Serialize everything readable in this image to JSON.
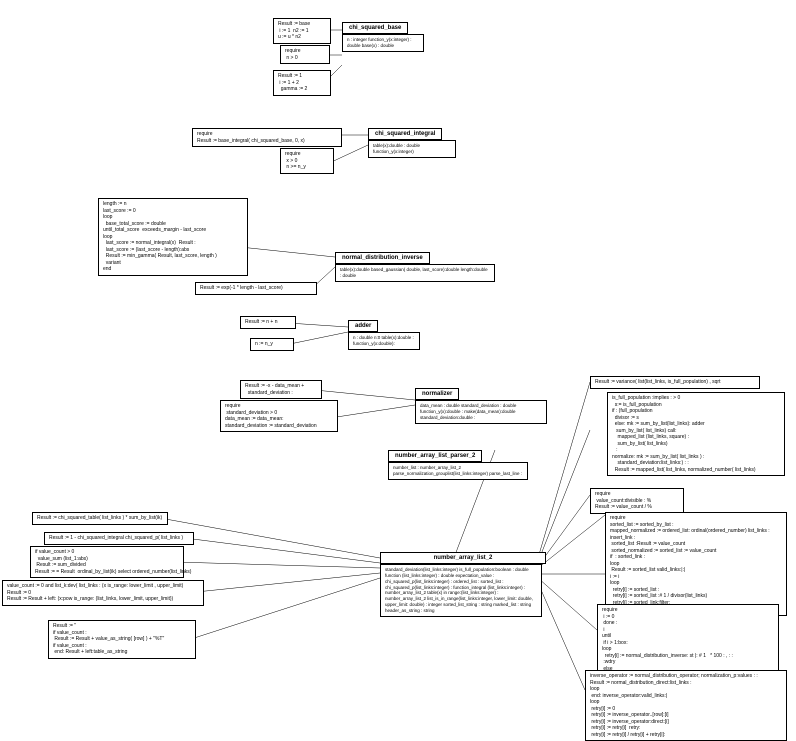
{
  "nodes": {
    "csb_note1": "Result := base\n i := 1  n2 := 1\nu := u * n2 ",
    "csb_note2": "require\n n > 0",
    "csb_note3": "Result := 1\n i := 1 + 2\n  gamma := 2",
    "csb_title": "chi_squared_base",
    "csb_attrs": "n : integer\nfunction_y(x:integer) : double\nbase(x) : double",
    "csi_note1": "require\nResult := base_integral( chi_squared_base, 0, x)",
    "csi_note2": "require\n x > 0\n n >= n_y",
    "csi_title": "chi_squared_integral",
    "csi_attrs": "table(x):double : double\nfunction_y(x:integer)",
    "ndi_note1": "length := n\nlast_score := 0\nloop\n  base_total_score := double\nuntil_total_score  exceeds_margin - last_score\nloop\n  last_score := normal_integral(x)  Result :\n  last_score := (last_score - length):abs\n  Result := min_gamma( Result, last_score, length )\n  variant\nend",
    "ndi_note2": "Result := exp(-1 * length - last_score)",
    "ndi_title": "normal_distribution_inverse",
    "ndi_attrs": "table(x):double\nbased_gaussian( double, last_score):double length:double : double",
    "add_note1": "Result := n + n",
    "add_note2": "n := n_y",
    "add_title": "adder",
    "add_attrs": "n : double  n:0\ntable(x):double :\nfunction_y(x:double):",
    "norm_note1": "Result := -x - data_mean +\n  standard_deviation :",
    "norm_note2": "require\n standard_deviation > 0\ndata_mean := data_mean:\nstandard_deviation := standard_deviation",
    "norm_title": "normalizer",
    "norm_attrs": "data_mean : double\nstandard_deviation : double\nfunction_y(x):double :\nmake(data_mean):double standard_deviation:double :",
    "nalp_title": "number_array_list_parser_2",
    "nalp_attrs": "number_list : number_array_list_2\nparse_normalization_grouplist(list_links:integer)\nparse_last_line :",
    "nal_title": "number_array_list_2",
    "nal_attrs": "standard_deviation(list_links:integer) is_full_population:boolean : double\nfunction (list_links:integer) : double\nexpectation_value : \nchi_squared_p(list_links:integer) :\n  ordered_list : sorted_list :\nchi_squared_p(list_links:integer) :\n  function_integral (list_links:integer) : number_array_list_2\ntable(x) in range:(list_links:integer) : number_array_list_2\nlist_is_in_range(list_links:integer, lower_limit: double, upper_limit: double) : integer\nsorted_list_string : string\nmarked_list : string\nheader_as_string : string",
    "left_note1": "Result := chi_squared_table( list_links ) * sum_by_list(ik)",
    "left_note2": "Result := 1 - chi_squared_integral chi_squared_p( list_links )",
    "left_note3": "if value_count > 0\n  value_sum (list_1:abs)\n Result := sum_divided\nResult := = Result  ordinal_by_list(ik) select ordered_number(list_links)",
    "left_note4": "value_count := 0 and list_k:dev( list_links : (x is_range: lower_limit , upper_limit)\nResult := 0\nResult := Result + left: (x:pow is_range: (list_links, lower_limit, upper_limit))",
    "left_note5": "Result := ''\nif value_count :\n Result := Result + value_as_string( [row] ) + \"%T\"\nif value_count :\n end: Result + left:table_as_string",
    "right_note1": "Result := variance( list(list_links, is_full_population) , sqrt",
    "right_note2": "is_full_population :implies : > 0\n  s:= is_full_population\nif : (full_population\n  divisor := s\n  else: mk := sum_by_list(list_links): adder\n   sum_by_list( list_links) call:\n    mapped_list (list_links, square) :\n    sum_by_list( list_links)\n   :\nnormalize: mk := sum_by_list( list_links ) :\n    standard_deviation:list_links:) : :\n  Result := mapped_list( list_links, normalized_number( list_links)",
    "right_note3": "require\n value_count:divisible : %\nResult := value_count / %",
    "right_note4": "require\nsorted_list := sorted_by_list :\nmapped_normalized := ordered_list: ordinal(ordered_number) list_links :\ninsert_link :\n sorted_list :Result := value_count\n sorted_normalized := sorted_list := value_count\nif  : sorted_link :\nloop\n Result := sorted_list valid_links:|:|\ni := i\nloop\n  retry[i] := sorted_list :\n  retry[i] := sorted_list :# 1 / divisor(list_links)\n  retry[i] := sorted_link:filter:\n  sorted_link:sorted_link filter:",
    "right_note5": "require\n i := 0\n done :\n i\nuntil\n if i > 1:box:\nloop\n  retry[i] := normal_distribution_inverse: st |: # 1   * 100 : , : :\n :wdry\n else\n  :wdry\n retry[i] := retry[i - 1]",
    "right_note6": "inverse_operator := normal_distribution_operator; normalization_p:values : :\nResult := normal_distribution_direct:list_links :\nloop\n end: inverse_operator:valid_links:|\nloop\n retry[i] := 0\n retry[i] := inverse_operator..[row]:[i]\n retry[i] := inverse_operator:direct:[i]\n retry[i] := retry[i]  retry:\n retry[i] := retry[i] / retry[i] + retry[i]:"
  }
}
